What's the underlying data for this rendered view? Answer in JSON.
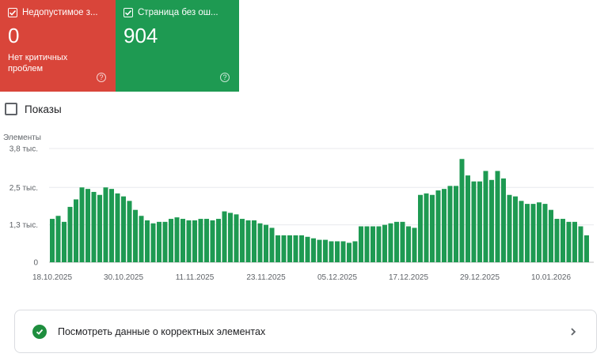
{
  "cards": [
    {
      "title": "Недопустимое з...",
      "value": "0",
      "subtitle": "Нет критичных проблем",
      "color": "#d9453a",
      "checked": true,
      "help_icon": "help-circle-icon"
    },
    {
      "title": "Страница без ош...",
      "value": "904",
      "subtitle": "",
      "color": "#1e9a52",
      "checked": true,
      "help_icon": "help-circle-icon"
    }
  ],
  "impressions_toggle": {
    "label": "Показы",
    "checked": false
  },
  "chart_data": {
    "type": "bar",
    "ylabel": "Элементы",
    "ylim": [
      0,
      3800
    ],
    "yticks": [
      {
        "value": 0,
        "label": "0"
      },
      {
        "value": 1250,
        "label": "1,3 тыс."
      },
      {
        "value": 2500,
        "label": "2,5 тыс."
      },
      {
        "value": 3800,
        "label": "3,8 тыс."
      }
    ],
    "xtick_labels": [
      "18.10.2025",
      "30.10.2025",
      "11.11.2025",
      "23.11.2025",
      "05.12.2025",
      "17.12.2025",
      "29.12.2025",
      "10.01.2026"
    ],
    "xtick_every": 12,
    "start_date": "18.10.2025",
    "color": "#1e9a52",
    "grid": true,
    "values": [
      1450,
      1550,
      1350,
      1850,
      2100,
      2500,
      2450,
      2350,
      2250,
      2500,
      2450,
      2300,
      2200,
      2050,
      1750,
      1550,
      1400,
      1300,
      1350,
      1350,
      1450,
      1500,
      1450,
      1400,
      1400,
      1450,
      1450,
      1400,
      1450,
      1700,
      1650,
      1600,
      1450,
      1400,
      1400,
      1300,
      1250,
      1150,
      900,
      900,
      900,
      900,
      900,
      850,
      800,
      750,
      750,
      700,
      700,
      700,
      650,
      700,
      1200,
      1200,
      1200,
      1200,
      1250,
      1300,
      1350,
      1350,
      1200,
      1150,
      2250,
      2300,
      2250,
      2400,
      2450,
      2550,
      2550,
      3450,
      2900,
      2700,
      2700,
      3050,
      2750,
      3050,
      2800,
      2250,
      2200,
      2050,
      1950,
      1950,
      2000,
      1950,
      1750,
      1450,
      1450,
      1350,
      1350,
      1200,
      900
    ]
  },
  "footer": {
    "label": "Посмотреть данные о корректных элементах",
    "icon": "check-circle-icon",
    "arrow_icon": "chevron-right-icon"
  }
}
